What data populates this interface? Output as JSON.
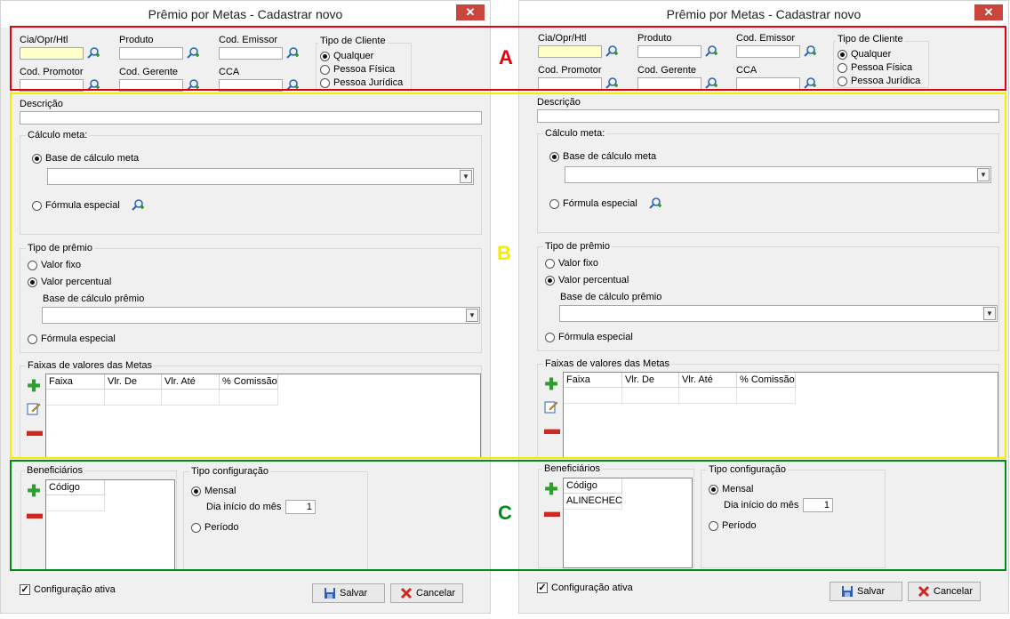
{
  "window": {
    "title": "Prêmio por Metas - Cadastrar novo",
    "close_glyph": "✕"
  },
  "header": {
    "cia_label": "Cia/Opr/Htl",
    "produto_label": "Produto",
    "cod_emissor_label": "Cod. Emissor",
    "cod_promotor_label": "Cod. Promotor",
    "cod_gerente_label": "Cod. Gerente",
    "cca_label": "CCA",
    "tipo_cliente": {
      "title": "Tipo de Cliente",
      "options": [
        "Qualquer",
        "Pessoa Física",
        "Pessoa Jurídica"
      ],
      "selected": "Qualquer"
    }
  },
  "descricao_label": "Descrição",
  "calculo_meta": {
    "title": "Cálculo meta:",
    "base_label": "Base de cálculo meta",
    "formula_label": "Fórmula especial",
    "selected": "base"
  },
  "tipo_premio": {
    "title": "Tipo de prêmio",
    "valor_fixo": "Valor fixo",
    "valor_percentual": "Valor percentual",
    "base_premio_label": "Base de cálculo prêmio",
    "formula_label": "Fórmula especial",
    "selected": "valor_percentual"
  },
  "faixas": {
    "title": "Faixas de valores das Metas",
    "columns": [
      "Faixa",
      "Vlr. De",
      "Vlr. Até",
      "% Comissão"
    ]
  },
  "beneficiarios": {
    "title": "Beneficiários",
    "column": "Código",
    "left_rows": [],
    "right_rows": [
      "ALINECHEC"
    ]
  },
  "tipo_configuracao": {
    "title": "Tipo configuração",
    "mensal": "Mensal",
    "dia_inicio_label": "Dia início do mês",
    "dia_inicio_value": "1",
    "periodo": "Período",
    "selected": "mensal"
  },
  "footer": {
    "config_ativa_label": "Configuração ativa",
    "config_ativa_checked": true,
    "salvar_label": "Salvar",
    "cancelar_label": "Cancelar"
  },
  "annotations": {
    "a": "A",
    "b": "B",
    "c": "C",
    "color_a": "#e3000f",
    "color_b": "#f5ec00",
    "color_c": "#008a16"
  },
  "icons": [
    "search-add-icon",
    "add-icon",
    "edit-icon",
    "remove-icon",
    "save-icon",
    "cancel-icon",
    "close-icon",
    "chevron-down-icon"
  ]
}
